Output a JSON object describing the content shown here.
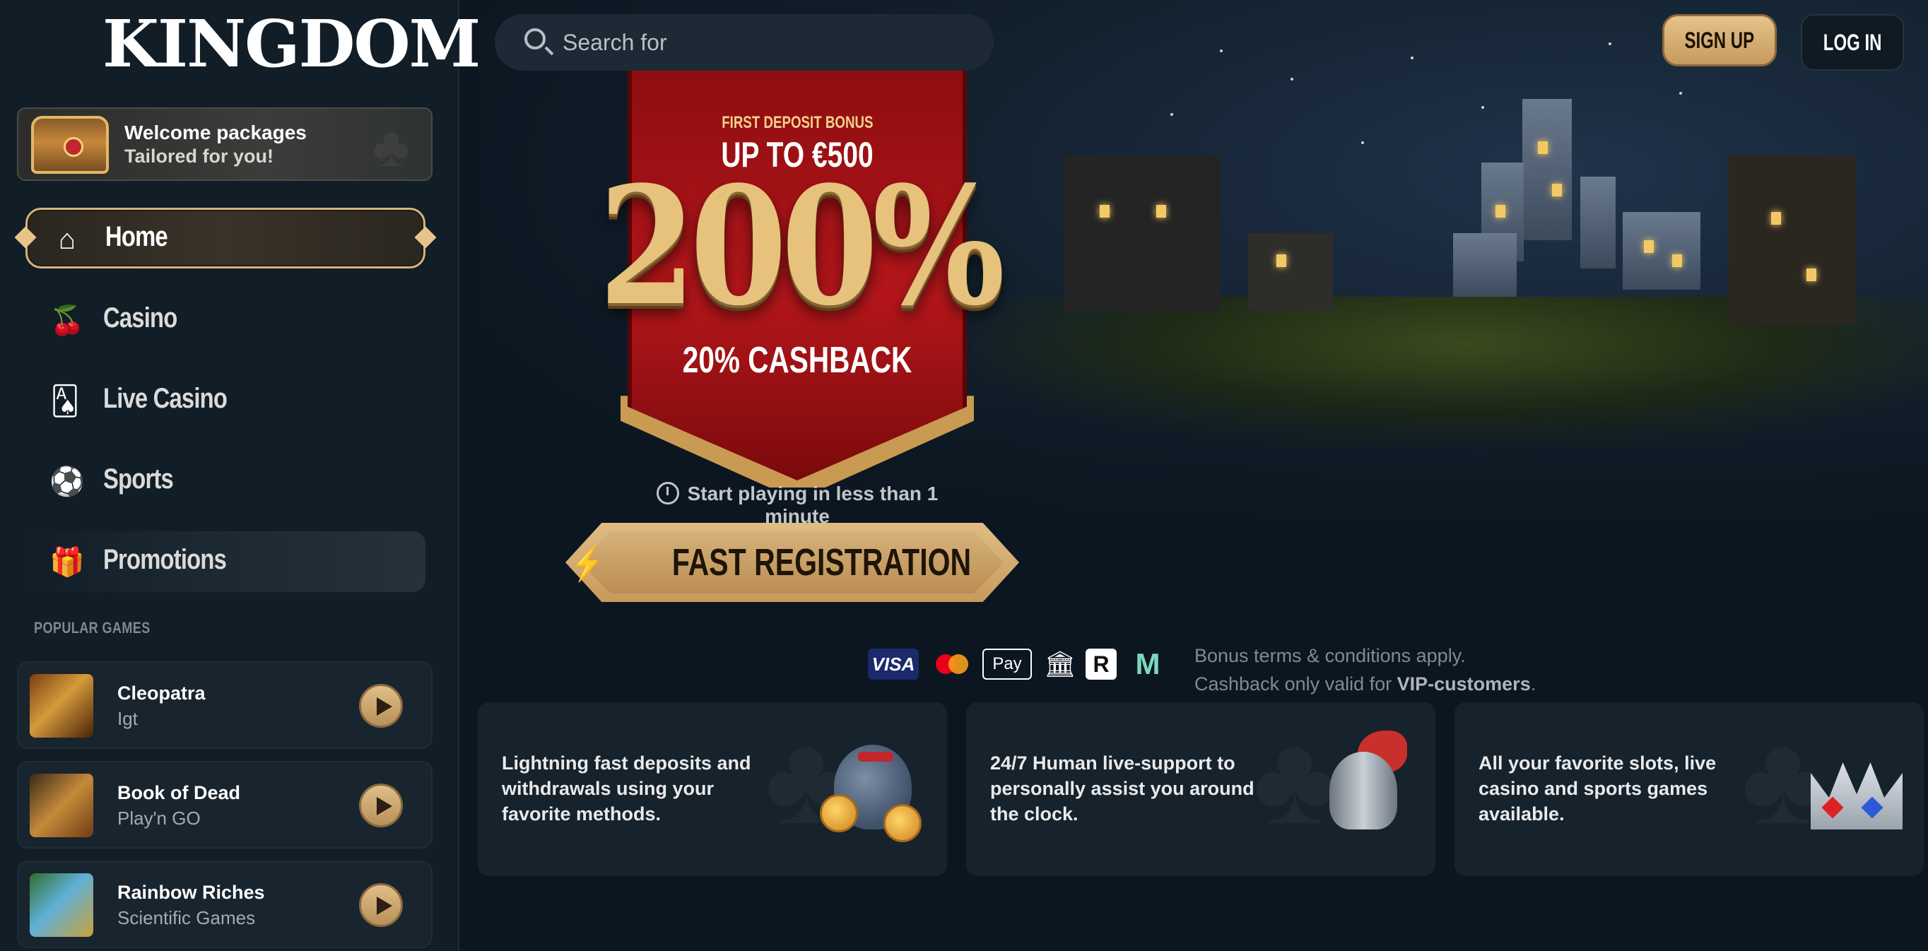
{
  "brand": {
    "logo": "KINGDOM",
    "accent": "#d7b27a",
    "primary_bg": "#0c1620"
  },
  "sidebar": {
    "welcome": {
      "title": "Welcome packages",
      "subtitle": "Tailored for you!"
    },
    "nav": [
      {
        "label": "Home",
        "icon": "home-icon",
        "active": true
      },
      {
        "label": "Casino",
        "icon": "cherries-icon"
      },
      {
        "label": "Live Casino",
        "icon": "cards-icon"
      },
      {
        "label": "Sports",
        "icon": "soccer-ball-icon"
      },
      {
        "label": "Promotions",
        "icon": "gift-icon"
      }
    ],
    "popular_label": "POPULAR GAMES",
    "games": [
      {
        "title": "Cleopatra",
        "provider": "Igt"
      },
      {
        "title": "Book of Dead",
        "provider": "Play'n GO"
      },
      {
        "title": "Rainbow Riches",
        "provider": "Scientific Games"
      }
    ]
  },
  "header": {
    "search_placeholder": "Search for",
    "signup": "SIGN UP",
    "login": "LOG IN"
  },
  "hero": {
    "first_deposit": "FIRST DEPOSIT BONUS",
    "upto": "UP TO €500",
    "percent": "200%",
    "cashback": "20% CASHBACK",
    "start_line": "Start playing in less than 1 minute",
    "cta": "FAST REGISTRATION"
  },
  "payments": [
    "visa-icon",
    "mastercard-icon",
    "apple-pay-icon",
    "bank-transfer-icon",
    "revolut-icon",
    "muchbetter-icon"
  ],
  "payment_labels": {
    "visa": "VISA",
    "apple": "Pay",
    "r": "R",
    "m": "M"
  },
  "terms": {
    "line1": "Bonus terms & conditions apply.",
    "line2_prefix": "Cashback only valid for ",
    "line2_bold": "VIP-customers",
    "line2_suffix": "."
  },
  "features": [
    {
      "text": "Lightning fast deposits and withdrawals using your favorite methods.",
      "icon": "money-bag-icon"
    },
    {
      "text": "24/7 Human live-support to personally assist you around the clock.",
      "icon": "knight-helmet-icon"
    },
    {
      "text": "All your favorite slots, live casino and sports games available.",
      "icon": "crown-icon"
    }
  ]
}
